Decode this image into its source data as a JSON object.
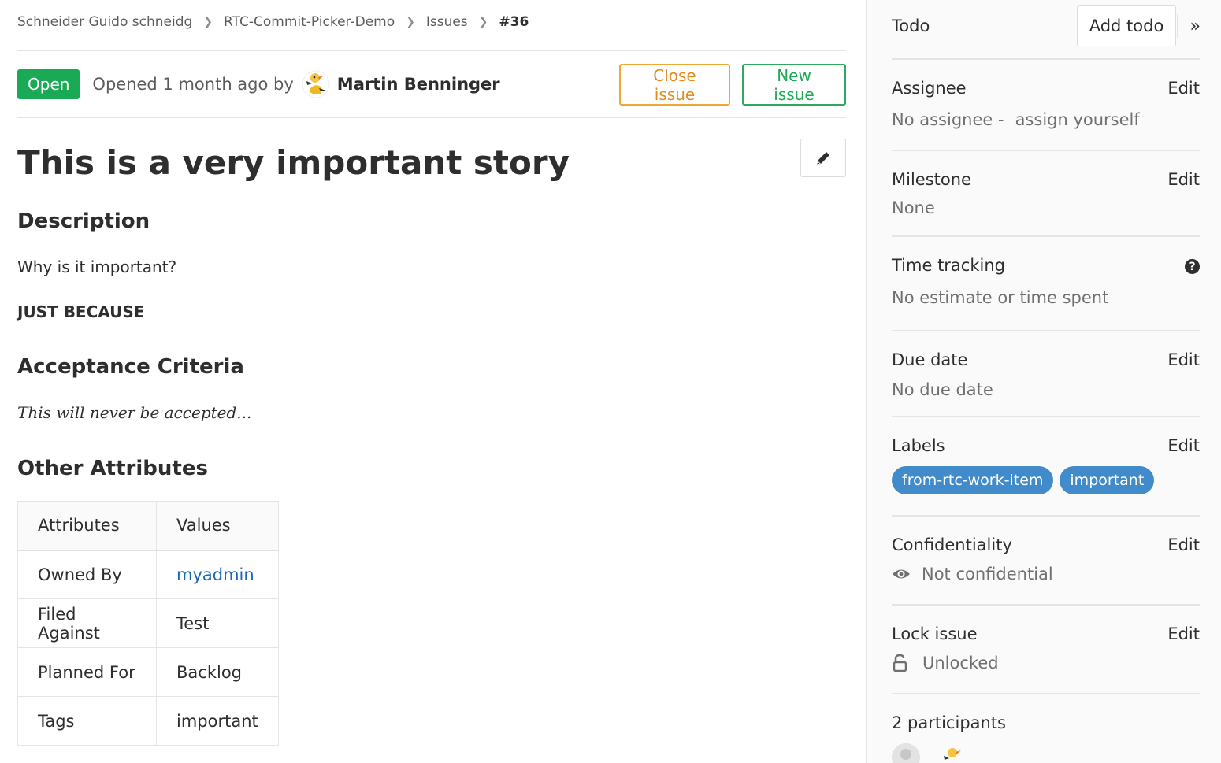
{
  "breadcrumb": {
    "items": [
      "Schneider Guido schneidg",
      "RTC-Commit-Picker-Demo",
      "Issues"
    ],
    "current": "#36"
  },
  "header": {
    "status": "Open",
    "opened_text": "Opened 1 month ago by",
    "author": "Martin Benninger",
    "close_label": "Close issue",
    "new_label": "New issue"
  },
  "issue": {
    "title": "This is a very important story",
    "description_heading": "Description",
    "description_question": "Why is it important?",
    "description_answer": "JUST BECAUSE",
    "acceptance_heading": "Acceptance Criteria",
    "acceptance_text": "This will never be accepted...",
    "other_heading": "Other Attributes",
    "table": {
      "headers": [
        "Attributes",
        "Values"
      ],
      "rows": [
        [
          "Owned By",
          "myadmin"
        ],
        [
          "Filed Against",
          "Test"
        ],
        [
          "Planned For",
          "Backlog"
        ],
        [
          "Tags",
          "important"
        ]
      ]
    }
  },
  "sidebar": {
    "todo_label": "Todo",
    "add_todo": "Add todo",
    "collapse_glyph": "»",
    "edit_label": "Edit",
    "assignee": {
      "title": "Assignee",
      "value": "No assignee -",
      "link": "assign yourself"
    },
    "milestone": {
      "title": "Milestone",
      "value": "None"
    },
    "time_tracking": {
      "title": "Time tracking",
      "value": "No estimate or time spent",
      "help": "?"
    },
    "due_date": {
      "title": "Due date",
      "value": "No due date"
    },
    "labels": {
      "title": "Labels",
      "items": [
        "from-rtc-work-item",
        "important"
      ],
      "color": "#428bca"
    },
    "confidentiality": {
      "title": "Confidentiality",
      "value": "Not confidential"
    },
    "lock": {
      "title": "Lock issue",
      "value": "Unlocked"
    },
    "participants": {
      "title": "2 participants"
    }
  },
  "colors": {
    "open": "#1aaa55",
    "close_border": "#f0a835",
    "link": "#1b69b6"
  },
  "icons": [
    "chevron-right-icon",
    "pencil-icon",
    "question-circle-icon",
    "eye-icon",
    "unlock-icon",
    "double-chevron-right-icon"
  ]
}
